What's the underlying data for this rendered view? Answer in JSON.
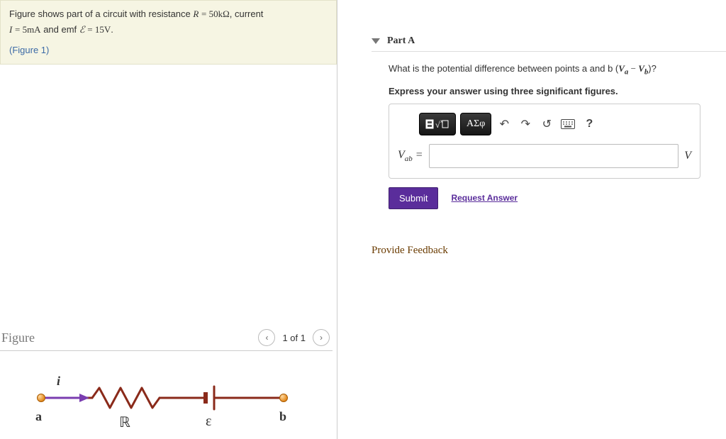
{
  "intro": {
    "line1_pre": "Figure shows part of a circuit with resistance ",
    "R_sym": "R",
    "eq": " = ",
    "R_val": "50kΩ",
    "comma_current": ", current",
    "line2_I": "I",
    "line2_Ival": "5mA",
    "line2_and_emf": " and emf ",
    "line2_E": "ℰ",
    "line2_Eval": "15V",
    "period": ".",
    "figure_link": "(Figure 1)"
  },
  "figure": {
    "title": "Figure",
    "pager_text": "1 of 1",
    "labels": {
      "i": "i",
      "a": "a",
      "b": "b",
      "R": "ℝ",
      "E": "ε"
    }
  },
  "partA": {
    "title": "Part A",
    "question_pre": "What is the potential difference between points a and b (",
    "Va": "V",
    "Va_sub": "a",
    "minus": " − ",
    "Vb": "V",
    "Vb_sub": "b",
    "question_post": ")?",
    "instruction": "Express your answer using three significant figures.",
    "tool_greek": "ΑΣφ",
    "answer_label_main": "V",
    "answer_label_sub": "ab",
    "answer_eq": " = ",
    "unit": "V",
    "submit": "Submit",
    "request": "Request Answer",
    "help": "?"
  },
  "feedback": "Provide Feedback"
}
